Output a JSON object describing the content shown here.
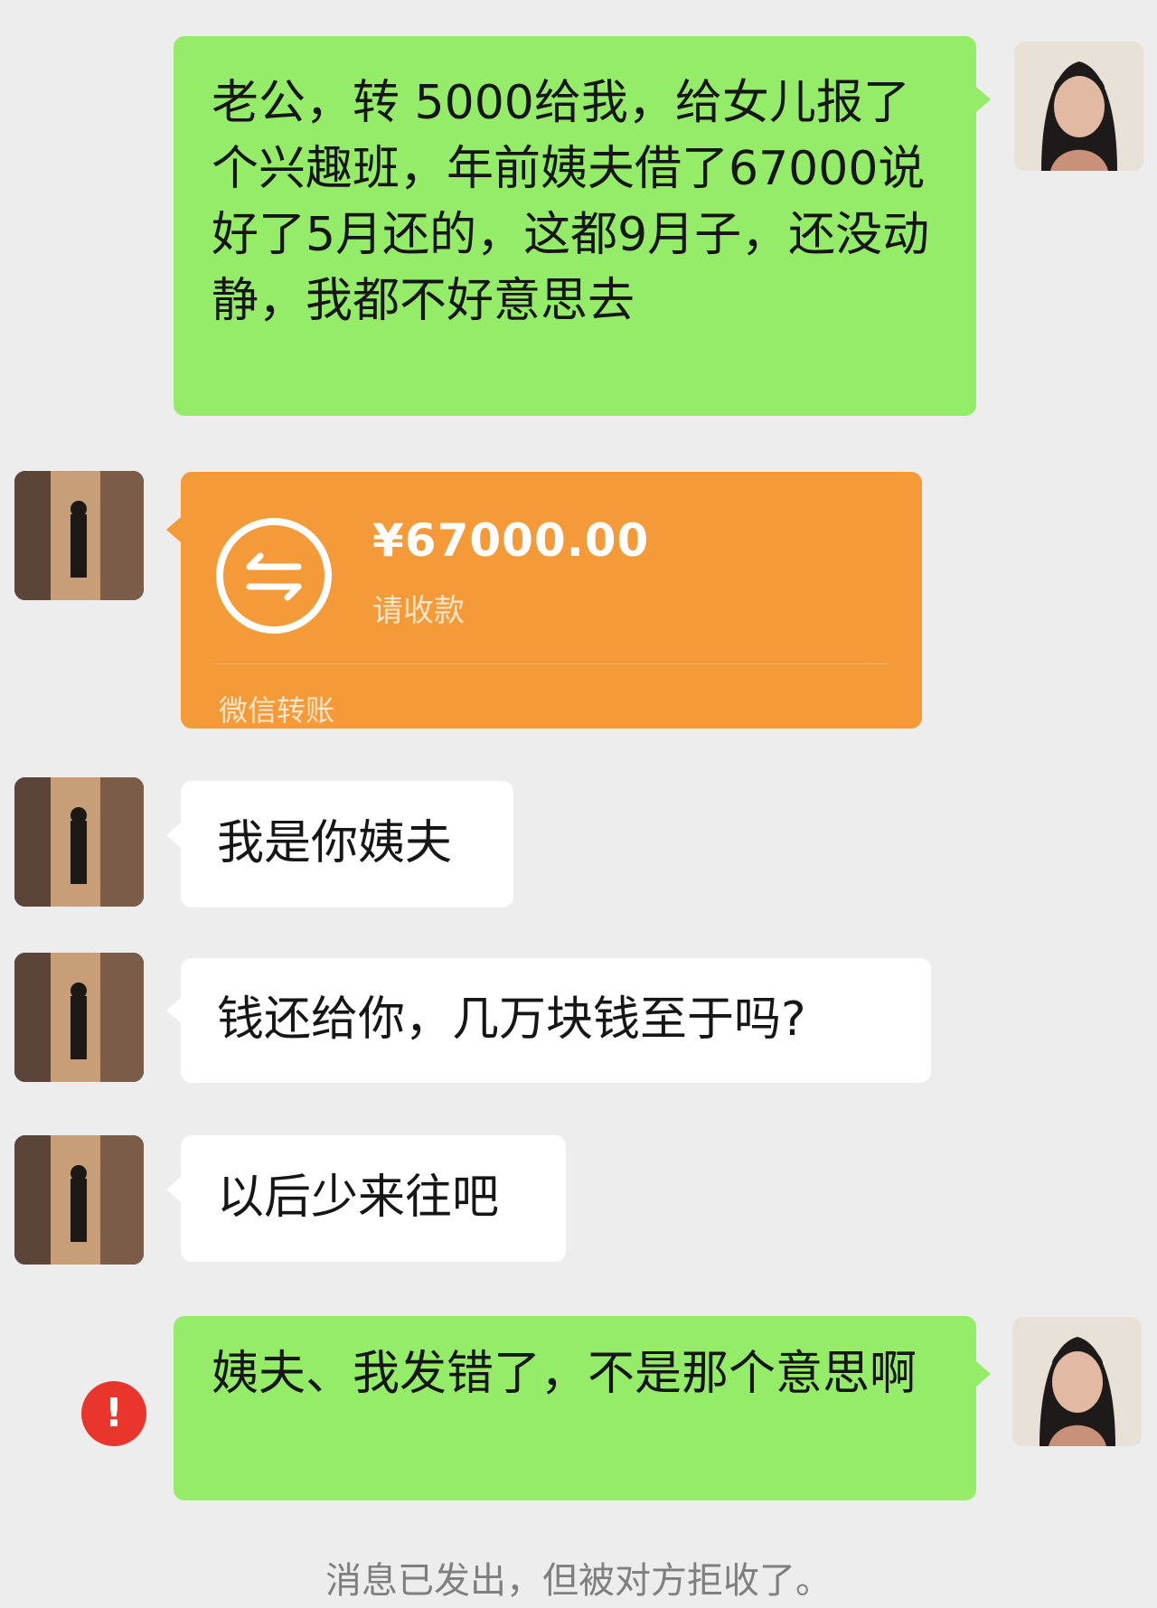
{
  "messages": [
    {
      "side": "right",
      "type": "text",
      "avatar": "female-avatar",
      "text": "老公，转 5000给我，给女儿报了个兴趣班，年前姨夫借了67000说好了5月还的，这都9月子，还没动静，我都不好意思去"
    },
    {
      "side": "left",
      "type": "transfer",
      "avatar": "male-avatar",
      "amount": "¥67000.00",
      "status": "请收款",
      "footer": "微信转账"
    },
    {
      "side": "left",
      "type": "text",
      "avatar": "male-avatar",
      "text": "我是你姨夫"
    },
    {
      "side": "left",
      "type": "text",
      "avatar": "male-avatar",
      "text": "钱还给你，几万块钱至于吗?"
    },
    {
      "side": "left",
      "type": "text",
      "avatar": "male-avatar",
      "text": "以后少来往吧"
    },
    {
      "side": "right",
      "type": "text",
      "avatar": "female-avatar",
      "status_icon": "error-icon",
      "status_symbol": "!",
      "text": "姨夫、我发错了，不是那个意思啊"
    }
  ],
  "system_note": "消息已发出，但被对方拒收了。",
  "colors": {
    "background": "#ededed",
    "self_bubble": "#95ec69",
    "other_bubble": "#ffffff",
    "transfer_bubble": "#f59a38",
    "error": "#e9352b"
  }
}
